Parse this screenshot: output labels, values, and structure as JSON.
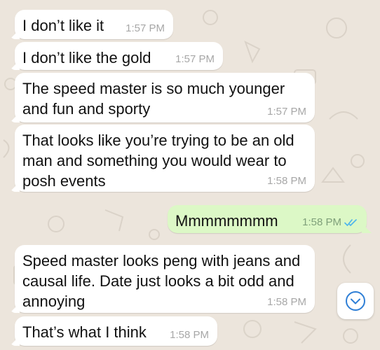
{
  "colors": {
    "wallpaper": "#ECE5DC",
    "incoming_bubble": "#FFFFFF",
    "outgoing_bubble": "#DCF8C6",
    "read_ticks": "#4FB6EC",
    "timestamp": "#A7A7A7"
  },
  "messages": [
    {
      "direction": "incoming",
      "text": "I don’t like it",
      "time": "1:57 PM"
    },
    {
      "direction": "incoming",
      "text": "I don’t like the gold",
      "time": "1:57 PM"
    },
    {
      "direction": "incoming",
      "text": "The speed master is so much younger\nand fun and sporty",
      "time": "1:57 PM"
    },
    {
      "direction": "incoming",
      "text": "That looks like you’re trying to be an old\nman and something you would wear to\nposh events",
      "time": "1:58 PM"
    },
    {
      "direction": "outgoing",
      "text": "Mmmmmmmm",
      "time": "1:58 PM",
      "status": "read"
    },
    {
      "direction": "incoming",
      "text": "Speed master looks peng with jeans and\ncausal life. Date just looks a bit odd and\nannoying",
      "time": "1:58 PM"
    },
    {
      "direction": "incoming",
      "text": "That’s what I think",
      "time": "1:58 PM"
    }
  ],
  "scroll_button": {
    "icon": "chevron-down-circle-icon"
  }
}
